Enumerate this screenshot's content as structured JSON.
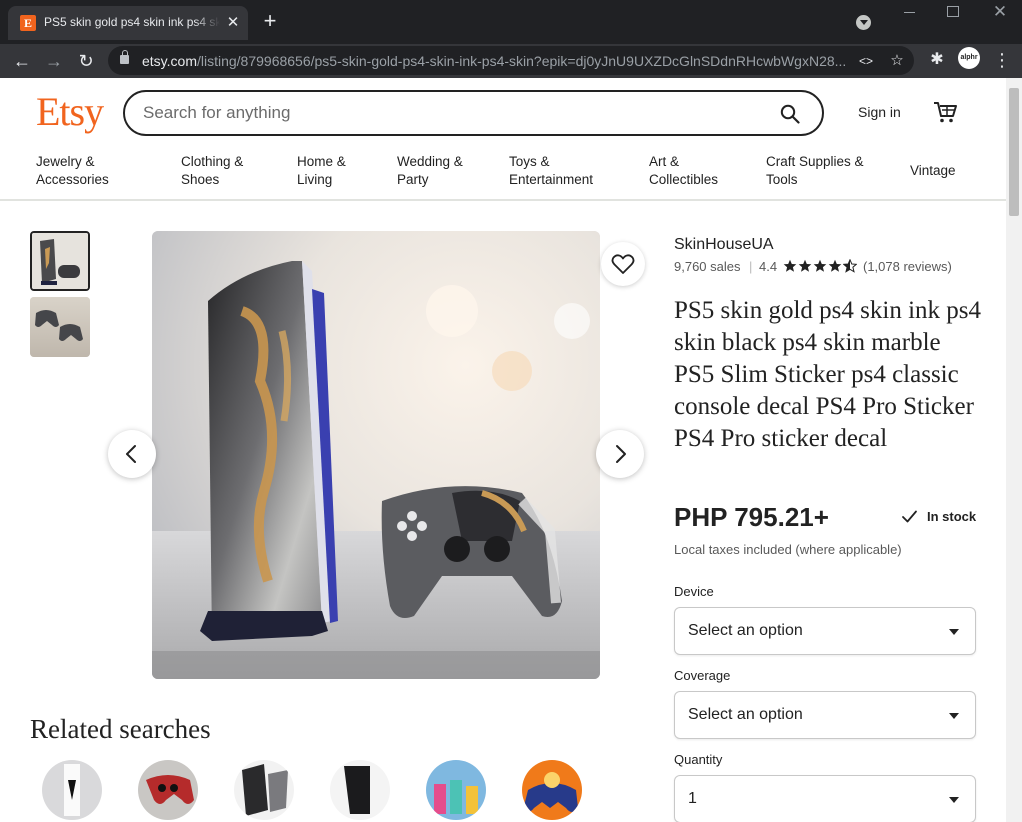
{
  "browser": {
    "tab_title": "PS5 skin gold ps4 skin ink ps4 skin",
    "tab_favicon_letter": "E",
    "url_domain": "etsy.com",
    "url_path": "/listing/879968656/ps5-skin-gold-ps4-skin-ink-ps4-skin?epik=dj0yJnU9UXZDcGlnSDdnRHcwbWgxN28...",
    "profile_label": "alphr"
  },
  "header": {
    "logo": "Etsy",
    "search_placeholder": "Search for anything",
    "signin_label": "Sign in"
  },
  "categories": [
    {
      "line1": "Jewelry &",
      "line2": "Accessories"
    },
    {
      "line1": "Clothing &",
      "line2": "Shoes"
    },
    {
      "line1": "Home &",
      "line2": "Living"
    },
    {
      "line1": "Wedding &",
      "line2": "Party"
    },
    {
      "line1": "Toys &",
      "line2": "Entertainment"
    },
    {
      "line1": "Art &",
      "line2": "Collectibles"
    },
    {
      "line1": "Craft Supplies &",
      "line2": "Tools"
    },
    {
      "line1": "Vintage",
      "line2": ""
    }
  ],
  "listing": {
    "shop_name": "SkinHouseUA",
    "sales": "9,760 sales",
    "rating": "4.4",
    "rating_stars": 4.4,
    "reviews": "(1,078 reviews)",
    "title": "PS5 skin gold ps4 skin ink ps4 skin black ps4 skin marble PS5 Slim Sticker ps4 classic console decal PS4 Pro Sticker PS4 Pro sticker decal",
    "price": "PHP 795.21+",
    "stock_status": "In stock",
    "taxes_note": "Local taxes included (where applicable)",
    "options": [
      {
        "label": "Device",
        "value": "Select an option"
      },
      {
        "label": "Coverage",
        "value": "Select an option"
      },
      {
        "label": "Quantity",
        "value": "1"
      }
    ]
  },
  "related": {
    "title": "Related searches"
  },
  "colors": {
    "brand": "#f1641e",
    "text": "#222222",
    "muted": "#595959"
  }
}
